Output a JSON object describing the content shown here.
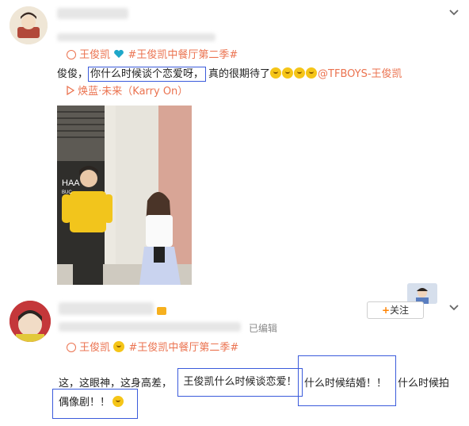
{
  "post1": {
    "topic_user": "王俊凯",
    "topic_tag": "#王俊凯中餐厅第二季#",
    "text_prefix": "俊俊，",
    "text_boxed": "你什么时候谈个恋爱呀，",
    "text_after": "真的很期待了",
    "mention": "@TFBOYS-王俊凯",
    "music_label": "焕蓝·未来（Karry On）"
  },
  "post2": {
    "edited_label": "已编辑",
    "follow_label": "关注",
    "topic_user": "王俊凯",
    "topic_tag": "#王俊凯中餐厅第二季#",
    "text_prefix": "这，这眼神，这身高差，",
    "text_boxed1": "王俊凯什么时候谈恋爱！",
    "text_boxed2": "什么时候结婚！！",
    "text_after": "什么时候拍",
    "text_line2": "偶像剧！！"
  },
  "photo": {
    "storefront_letters": "HAA",
    "storefront_small": "BUC"
  },
  "icons": {
    "chevron": "chevron-down-icon",
    "super_topic": "super-topic-icon",
    "play": "play-icon",
    "heart": "blue-heart-icon"
  },
  "colors": {
    "link": "#eb7350",
    "annotation_box": "#3b5bdb",
    "heart": "#1ea7c9"
  }
}
